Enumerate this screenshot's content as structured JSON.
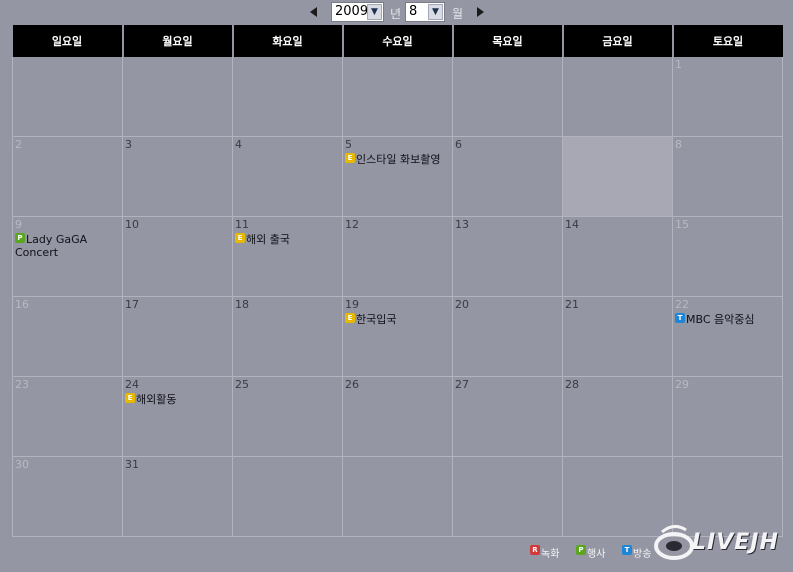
{
  "nav": {
    "year": "2009",
    "year_unit": "년",
    "month": "8",
    "month_unit": "월"
  },
  "weekdays": [
    "일요일",
    "월요일",
    "화요일",
    "수요일",
    "목요일",
    "금요일",
    "토요일"
  ],
  "weeks": [
    [
      {
        "day": "",
        "faded": false,
        "events": []
      },
      {
        "day": "",
        "faded": false,
        "events": []
      },
      {
        "day": "",
        "faded": false,
        "events": []
      },
      {
        "day": "",
        "faded": false,
        "events": []
      },
      {
        "day": "",
        "faded": false,
        "events": []
      },
      {
        "day": "",
        "faded": false,
        "events": []
      },
      {
        "day": "1",
        "faded": true,
        "events": []
      }
    ],
    [
      {
        "day": "2",
        "faded": true,
        "events": []
      },
      {
        "day": "3",
        "faded": false,
        "events": []
      },
      {
        "day": "4",
        "faded": false,
        "events": []
      },
      {
        "day": "5",
        "faded": false,
        "events": [
          {
            "type": "E",
            "title": "인스타일 화보촬영"
          }
        ]
      },
      {
        "day": "6",
        "faded": false,
        "events": []
      },
      {
        "day": "",
        "faded": false,
        "today": true,
        "events": []
      },
      {
        "day": "8",
        "faded": true,
        "events": []
      }
    ],
    [
      {
        "day": "9",
        "faded": true,
        "events": [
          {
            "type": "P",
            "title": "Lady GaGA Concert"
          }
        ]
      },
      {
        "day": "10",
        "faded": false,
        "events": []
      },
      {
        "day": "11",
        "faded": false,
        "events": [
          {
            "type": "E",
            "title": "해외 출국"
          }
        ]
      },
      {
        "day": "12",
        "faded": false,
        "events": []
      },
      {
        "day": "13",
        "faded": false,
        "events": []
      },
      {
        "day": "14",
        "faded": false,
        "events": []
      },
      {
        "day": "15",
        "faded": true,
        "events": []
      }
    ],
    [
      {
        "day": "16",
        "faded": true,
        "events": []
      },
      {
        "day": "17",
        "faded": false,
        "events": []
      },
      {
        "day": "18",
        "faded": false,
        "events": []
      },
      {
        "day": "19",
        "faded": false,
        "events": [
          {
            "type": "E",
            "title": "한국입국"
          }
        ]
      },
      {
        "day": "20",
        "faded": false,
        "events": []
      },
      {
        "day": "21",
        "faded": false,
        "events": []
      },
      {
        "day": "22",
        "faded": true,
        "events": [
          {
            "type": "T",
            "title": "MBC 음악중심"
          }
        ]
      }
    ],
    [
      {
        "day": "23",
        "faded": true,
        "events": []
      },
      {
        "day": "24",
        "faded": false,
        "events": [
          {
            "type": "E",
            "title": "해외활동"
          }
        ]
      },
      {
        "day": "25",
        "faded": false,
        "events": []
      },
      {
        "day": "26",
        "faded": false,
        "events": []
      },
      {
        "day": "27",
        "faded": false,
        "events": []
      },
      {
        "day": "28",
        "faded": false,
        "events": []
      },
      {
        "day": "29",
        "faded": true,
        "events": []
      }
    ],
    [
      {
        "day": "30",
        "faded": true,
        "events": []
      },
      {
        "day": "31",
        "faded": false,
        "events": []
      },
      {
        "day": "",
        "faded": false,
        "events": []
      },
      {
        "day": "",
        "faded": false,
        "events": []
      },
      {
        "day": "",
        "faded": false,
        "events": []
      },
      {
        "day": "",
        "faded": false,
        "events": []
      },
      {
        "day": "",
        "faded": false,
        "events": []
      }
    ]
  ],
  "badge_colors": {
    "E": "#e6b800",
    "P": "#5aa620",
    "T": "#1e86d6",
    "R": "#d23a3a"
  },
  "legend": [
    {
      "type": "R",
      "label": "녹화"
    },
    {
      "type": "P",
      "label": "행사"
    },
    {
      "type": "T",
      "label": "방송"
    }
  ],
  "logo": {
    "text": "LIVEJH"
  }
}
